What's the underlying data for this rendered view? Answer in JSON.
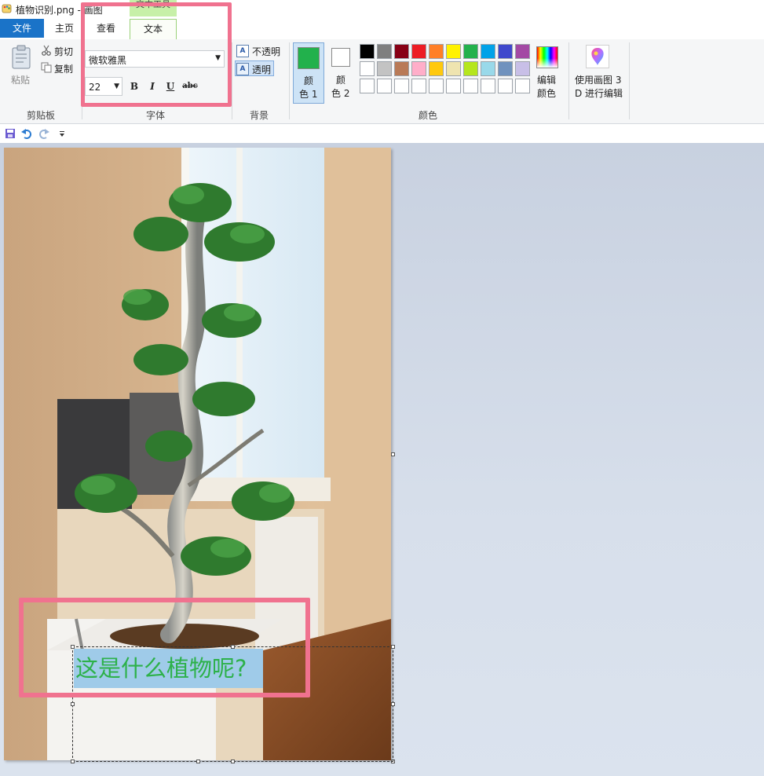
{
  "window": {
    "title": "植物识别.png - 画图",
    "context_tab_header": "文本工具"
  },
  "tabs": {
    "file": "文件",
    "home": "主页",
    "view": "查看",
    "text": "文本"
  },
  "ribbon": {
    "clipboard": {
      "paste": "粘贴",
      "cut": "剪切",
      "copy": "复制",
      "label": "剪贴板"
    },
    "font": {
      "family": "微软雅黑",
      "size": "22",
      "bold": "B",
      "italic": "I",
      "underline": "U",
      "strikethrough": "abc",
      "label": "字体"
    },
    "background": {
      "opaque": "不透明",
      "transparent": "透明",
      "label": "背景",
      "selected": "透明"
    },
    "colors": {
      "color1_line1": "颜",
      "color1_line2": "色 1",
      "color2_line1": "颜",
      "color2_line2": "色 2",
      "color1_value": "#22b14c",
      "color2_value": "#ffffff",
      "edit_line1": "编辑",
      "edit_line2": "颜色",
      "label": "颜色",
      "palette": [
        "#000000",
        "#7f7f7f",
        "#880015",
        "#ed1c24",
        "#ff7f27",
        "#fff200",
        "#22b14c",
        "#00a2e8",
        "#3f48cc",
        "#a349a4",
        "#ffffff",
        "#c3c3c3",
        "#b97a57",
        "#ffaec9",
        "#ffc90e",
        "#efe4b0",
        "#b5e61d",
        "#99d9ea",
        "#7092be",
        "#c8bfe7",
        "#ffffff",
        "#ffffff",
        "#ffffff",
        "#ffffff",
        "#ffffff",
        "#ffffff",
        "#ffffff",
        "#ffffff",
        "#ffffff",
        "#ffffff"
      ]
    },
    "paint3d": {
      "line1": "使用画图 3",
      "line2": "D 进行编辑"
    }
  },
  "quick_access": [
    "save-icon",
    "undo-icon",
    "redo-icon",
    "customize-dropdown-icon"
  ],
  "canvas": {
    "text_box_content": "这是什么植物呢?"
  },
  "colors": {
    "highlight": "#f0728f",
    "file_tab": "#1a73c8",
    "context_tab": "#c7f0a8",
    "text_color": "#2db14a",
    "text_bg": "#9fcbe9"
  }
}
